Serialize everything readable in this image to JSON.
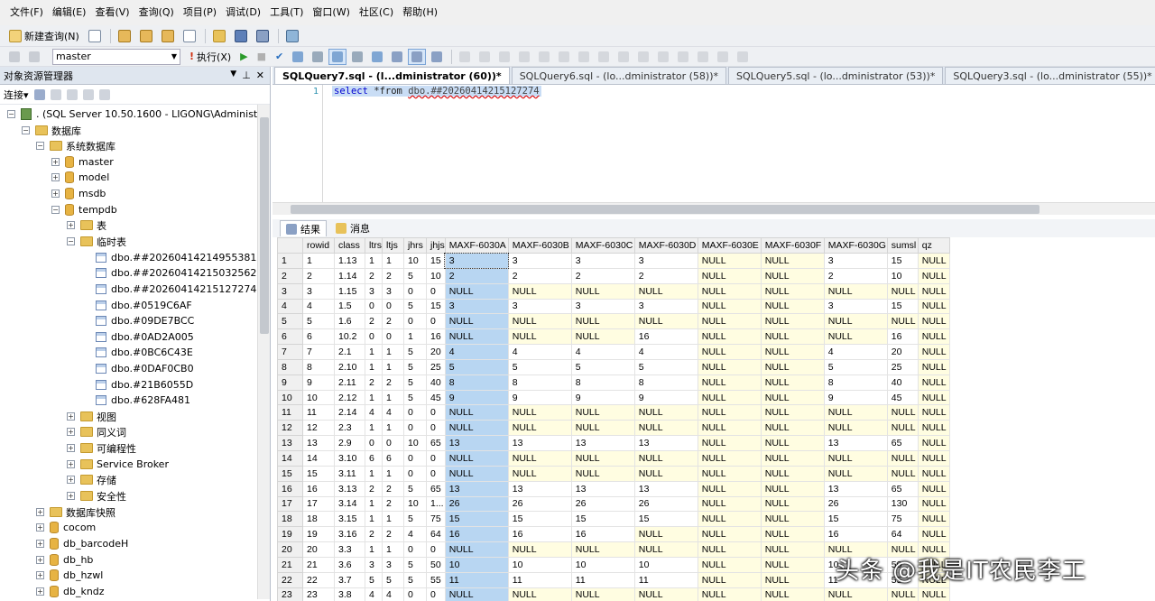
{
  "menubar": {
    "items": [
      "文件(F)",
      "编辑(E)",
      "查看(V)",
      "查询(Q)",
      "项目(P)",
      "调试(D)",
      "工具(T)",
      "窗口(W)",
      "社区(C)",
      "帮助(H)"
    ]
  },
  "toolbar": {
    "new_query_label": "新建查询(N)",
    "database_selected": "master",
    "execute_label": "执行(X)"
  },
  "object_explorer": {
    "title": "对象资源管理器",
    "connect_label": "连接",
    "server_label": ". (SQL Server 10.50.1600 - LIGONG\\Administrat",
    "nodes": {
      "databases": "数据库",
      "system_databases": "系统数据库",
      "master": "master",
      "model": "model",
      "msdb": "msdb",
      "tempdb": "tempdb",
      "tables": "表",
      "temp_tables": "临时表",
      "temp_table_items": [
        "dbo.##20260414214955381",
        "dbo.##20260414215032562",
        "dbo.##20260414215127274",
        "dbo.#0519C6AF",
        "dbo.#09DE7BCC",
        "dbo.#0AD2A005",
        "dbo.#0BC6C43E",
        "dbo.#0DAF0CB0",
        "dbo.#21B6055D",
        "dbo.#628FA481"
      ],
      "views": "视图",
      "synonyms": "同义词",
      "programmability": "可编程性",
      "service_broker": "Service Broker",
      "storage": "存储",
      "security": "安全性",
      "db_snapshots": "数据库快照",
      "user_databases": [
        "cocom",
        "db_barcodeH",
        "db_hb",
        "db_hzwl",
        "db_kndz"
      ]
    }
  },
  "editor": {
    "tabs": [
      "SQLQuery7.sql - (l...dministrator (60))*",
      "SQLQuery6.sql - (lo...dministrator (58))*",
      "SQLQuery5.sql - (lo...dministrator (53))*",
      "SQLQuery3.sql - (lo...dministrator (55))*"
    ],
    "line_number": "1",
    "code_keyword": "select",
    "code_rest": " *from ",
    "code_object": "dbo.##20260414215127274"
  },
  "results": {
    "tab_results": "结果",
    "tab_messages": "消息",
    "columns": [
      "",
      "rowid",
      "class",
      "ltrs",
      "ltjs",
      "jhrs",
      "jhjs",
      "MAXF-6030A",
      "MAXF-6030B",
      "MAXF-6030C",
      "MAXF-6030D",
      "MAXF-6030E",
      "MAXF-6030F",
      "MAXF-6030G",
      "sumsl",
      "qz"
    ],
    "rows": [
      [
        "1",
        "1",
        "1.13",
        "1",
        "1",
        "10",
        "15",
        "3",
        "3",
        "3",
        "3",
        "NULL",
        "NULL",
        "3",
        "15",
        "NULL"
      ],
      [
        "2",
        "2",
        "1.14",
        "2",
        "2",
        "5",
        "10",
        "2",
        "2",
        "2",
        "2",
        "NULL",
        "NULL",
        "2",
        "10",
        "NULL"
      ],
      [
        "3",
        "3",
        "1.15",
        "3",
        "3",
        "0",
        "0",
        "NULL",
        "NULL",
        "NULL",
        "NULL",
        "NULL",
        "NULL",
        "NULL",
        "NULL",
        "NULL"
      ],
      [
        "4",
        "4",
        "1.5",
        "0",
        "0",
        "5",
        "15",
        "3",
        "3",
        "3",
        "3",
        "NULL",
        "NULL",
        "3",
        "15",
        "NULL"
      ],
      [
        "5",
        "5",
        "1.6",
        "2",
        "2",
        "0",
        "0",
        "NULL",
        "NULL",
        "NULL",
        "NULL",
        "NULL",
        "NULL",
        "NULL",
        "NULL",
        "NULL"
      ],
      [
        "6",
        "6",
        "10.2",
        "0",
        "0",
        "1",
        "16",
        "NULL",
        "NULL",
        "NULL",
        "16",
        "NULL",
        "NULL",
        "NULL",
        "16",
        "NULL"
      ],
      [
        "7",
        "7",
        "2.1",
        "1",
        "1",
        "5",
        "20",
        "4",
        "4",
        "4",
        "4",
        "NULL",
        "NULL",
        "4",
        "20",
        "NULL"
      ],
      [
        "8",
        "8",
        "2.10",
        "1",
        "1",
        "5",
        "25",
        "5",
        "5",
        "5",
        "5",
        "NULL",
        "NULL",
        "5",
        "25",
        "NULL"
      ],
      [
        "9",
        "9",
        "2.11",
        "2",
        "2",
        "5",
        "40",
        "8",
        "8",
        "8",
        "8",
        "NULL",
        "NULL",
        "8",
        "40",
        "NULL"
      ],
      [
        "10",
        "10",
        "2.12",
        "1",
        "1",
        "5",
        "45",
        "9",
        "9",
        "9",
        "9",
        "NULL",
        "NULL",
        "9",
        "45",
        "NULL"
      ],
      [
        "11",
        "11",
        "2.14",
        "4",
        "4",
        "0",
        "0",
        "NULL",
        "NULL",
        "NULL",
        "NULL",
        "NULL",
        "NULL",
        "NULL",
        "NULL",
        "NULL"
      ],
      [
        "12",
        "12",
        "2.3",
        "1",
        "1",
        "0",
        "0",
        "NULL",
        "NULL",
        "NULL",
        "NULL",
        "NULL",
        "NULL",
        "NULL",
        "NULL",
        "NULL"
      ],
      [
        "13",
        "13",
        "2.9",
        "0",
        "0",
        "10",
        "65",
        "13",
        "13",
        "13",
        "13",
        "NULL",
        "NULL",
        "13",
        "65",
        "NULL"
      ],
      [
        "14",
        "14",
        "3.10",
        "6",
        "6",
        "0",
        "0",
        "NULL",
        "NULL",
        "NULL",
        "NULL",
        "NULL",
        "NULL",
        "NULL",
        "NULL",
        "NULL"
      ],
      [
        "15",
        "15",
        "3.11",
        "1",
        "1",
        "0",
        "0",
        "NULL",
        "NULL",
        "NULL",
        "NULL",
        "NULL",
        "NULL",
        "NULL",
        "NULL",
        "NULL"
      ],
      [
        "16",
        "16",
        "3.13",
        "2",
        "2",
        "5",
        "65",
        "13",
        "13",
        "13",
        "13",
        "NULL",
        "NULL",
        "13",
        "65",
        "NULL"
      ],
      [
        "17",
        "17",
        "3.14",
        "1",
        "2",
        "10",
        "1...",
        "26",
        "26",
        "26",
        "26",
        "NULL",
        "NULL",
        "26",
        "130",
        "NULL"
      ],
      [
        "18",
        "18",
        "3.15",
        "1",
        "1",
        "5",
        "75",
        "15",
        "15",
        "15",
        "15",
        "NULL",
        "NULL",
        "15",
        "75",
        "NULL"
      ],
      [
        "19",
        "19",
        "3.16",
        "2",
        "2",
        "4",
        "64",
        "16",
        "16",
        "16",
        "NULL",
        "NULL",
        "NULL",
        "16",
        "64",
        "NULL"
      ],
      [
        "20",
        "20",
        "3.3",
        "1",
        "1",
        "0",
        "0",
        "NULL",
        "NULL",
        "NULL",
        "NULL",
        "NULL",
        "NULL",
        "NULL",
        "NULL",
        "NULL"
      ],
      [
        "21",
        "21",
        "3.6",
        "3",
        "3",
        "5",
        "50",
        "10",
        "10",
        "10",
        "10",
        "NULL",
        "NULL",
        "10",
        "50",
        "NULL"
      ],
      [
        "22",
        "22",
        "3.7",
        "5",
        "5",
        "5",
        "55",
        "11",
        "11",
        "11",
        "11",
        "NULL",
        "NULL",
        "11",
        "55",
        "NULL"
      ],
      [
        "23",
        "23",
        "3.8",
        "4",
        "4",
        "0",
        "0",
        "NULL",
        "NULL",
        "NULL",
        "NULL",
        "NULL",
        "NULL",
        "NULL",
        "NULL",
        "NULL"
      ]
    ]
  },
  "watermark": "头条 @我是IT农民李工"
}
